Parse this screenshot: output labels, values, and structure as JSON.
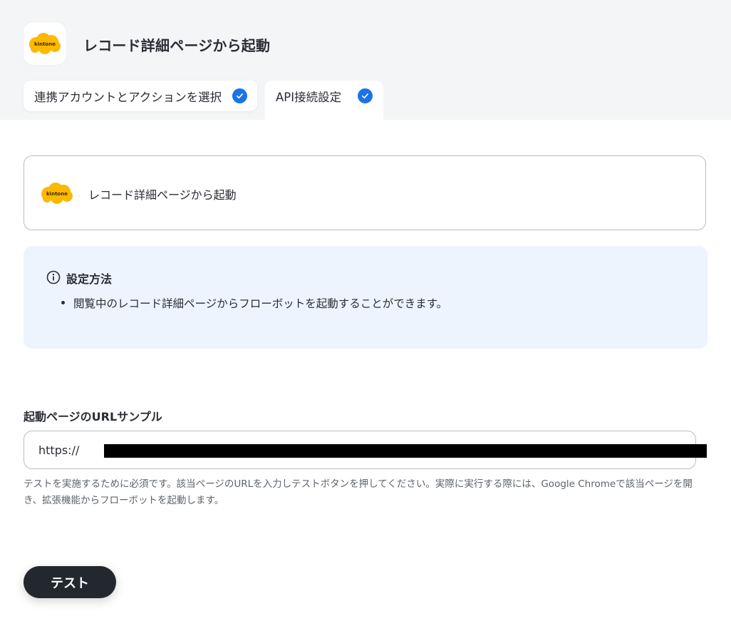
{
  "app": {
    "title": "レコード詳細ページから起動",
    "logo_text": "kintone",
    "brand_color": "#fcb900"
  },
  "tabs": [
    {
      "label": "連携アカウントとアクションを選択",
      "completed": true
    },
    {
      "label": "API接続設定",
      "completed": true
    }
  ],
  "trigger": {
    "label": "レコード詳細ページから起動",
    "logo_text": "kintone"
  },
  "info": {
    "title": "設定方法",
    "items": [
      "閲覧中のレコード詳細ページからフローボットを起動することができます。"
    ]
  },
  "url_field": {
    "label": "起動ページのURLサンプル",
    "value": "https://"
  },
  "help_text": "テストを実施するために必須です。該当ページのURLを入力しテストボタンを押してください。実際に実行する際には、Google Chromeで該当ページを開き、拡張機能からフローボットを起動します。",
  "actions": {
    "test_label": "テスト"
  },
  "colors": {
    "accent": "#1a73e8",
    "info_bg": "#edf4fd",
    "button_bg": "#23272e"
  }
}
